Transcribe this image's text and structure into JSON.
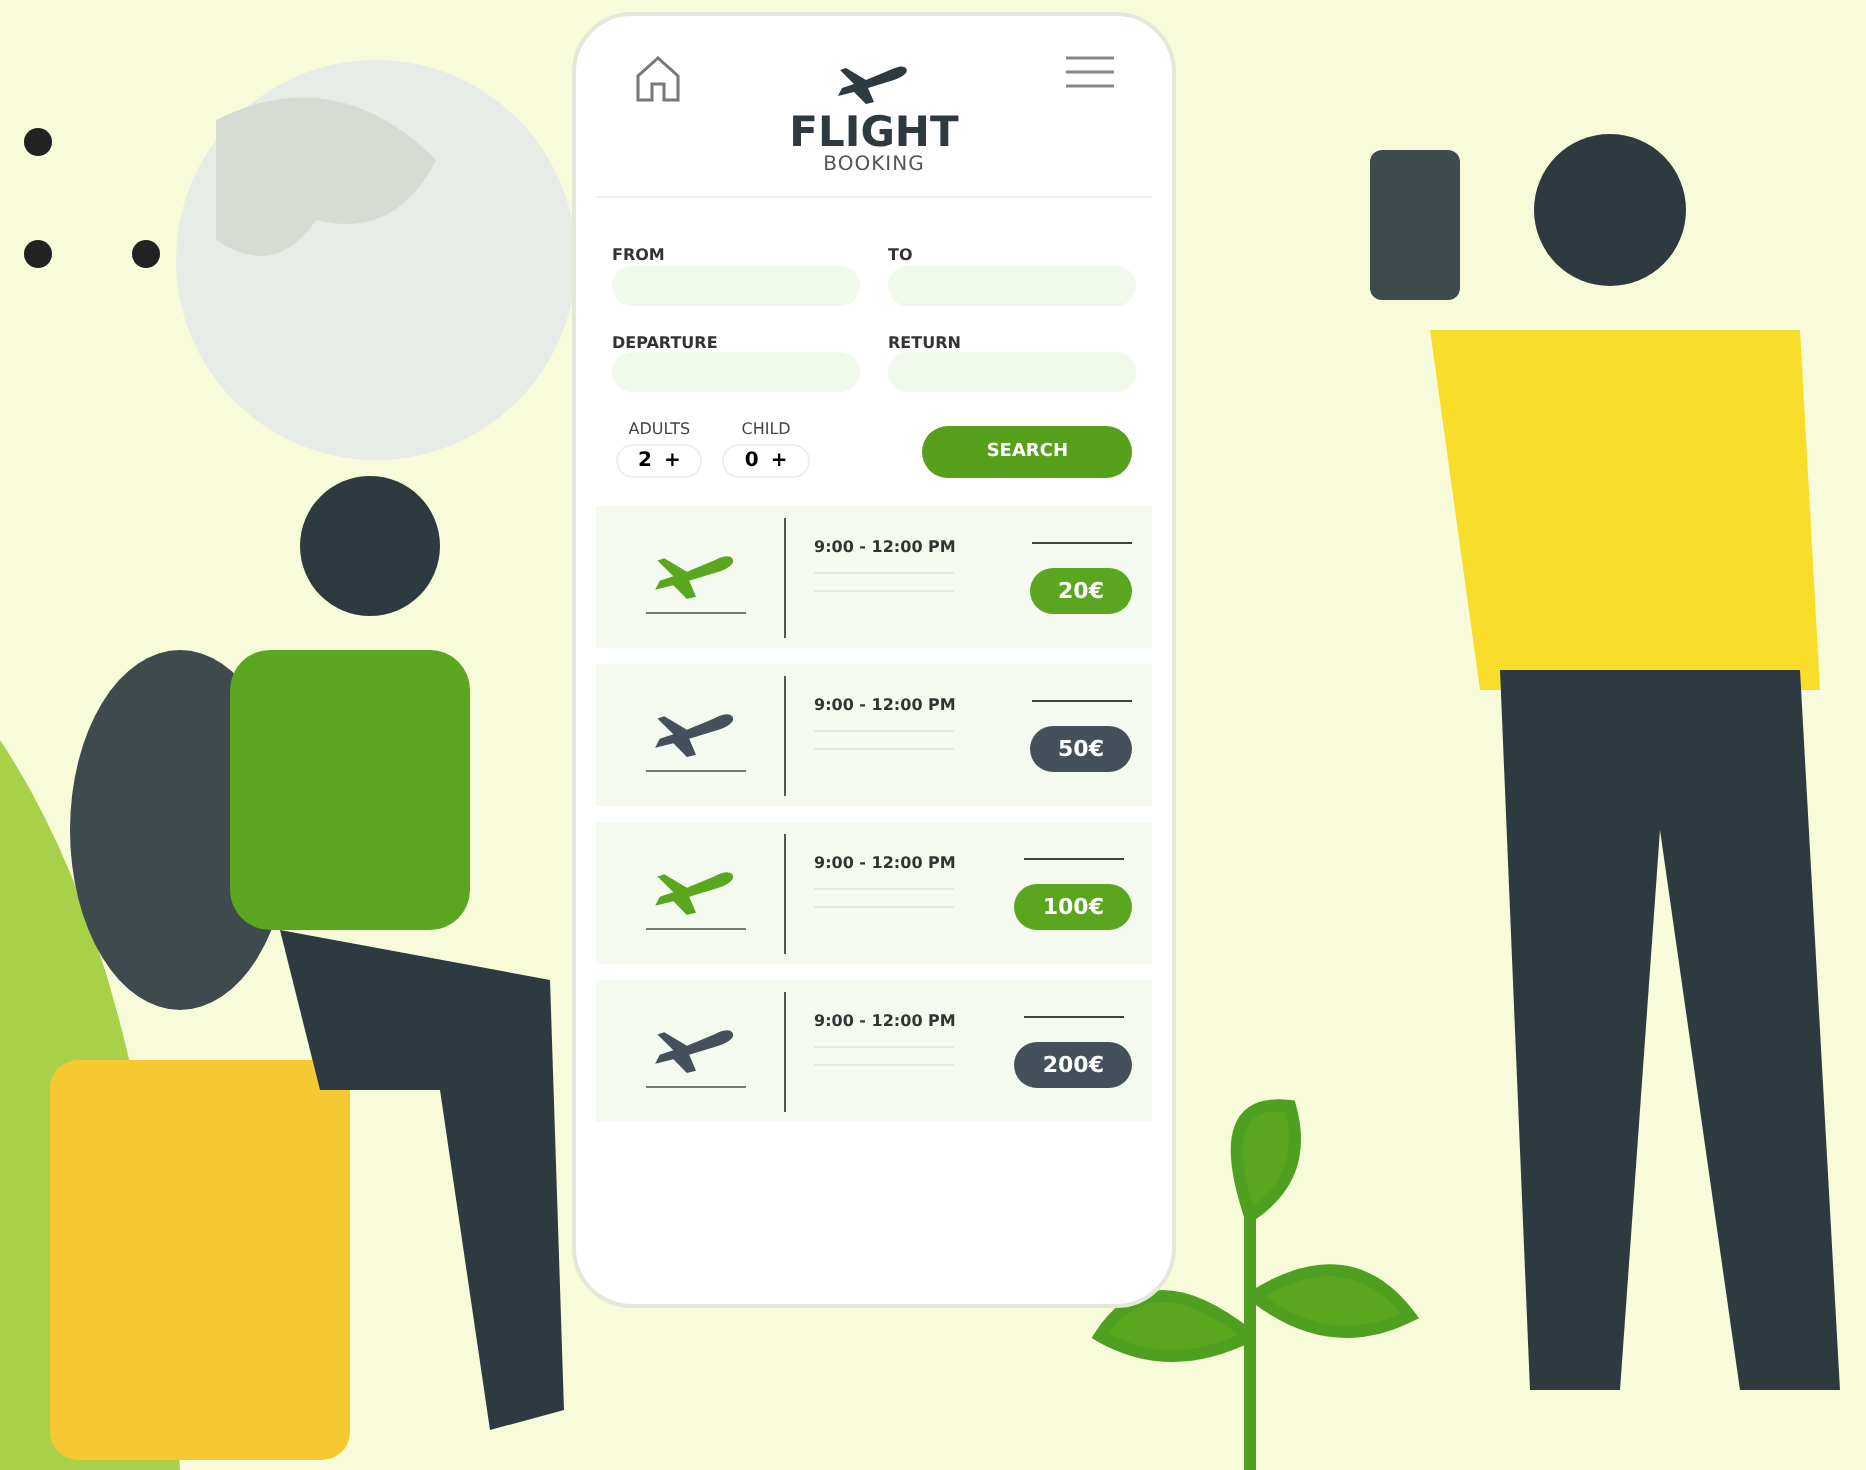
{
  "app": {
    "title": "FLIGHT",
    "subtitle": "BOOKING"
  },
  "form": {
    "fields": [
      {
        "label": "FROM"
      },
      {
        "label": "TO"
      },
      {
        "label": "DEPARTURE"
      },
      {
        "label": "RETURN"
      }
    ],
    "counters": [
      {
        "label": "ADULTS",
        "value": "2",
        "plus": "+"
      },
      {
        "label": "CHILD",
        "value": "0",
        "plus": "+"
      }
    ],
    "search_button": "SEARCH"
  },
  "flights": [
    {
      "time": "9:00 - 12:00 PM",
      "price": "20€",
      "color": "#5aa61e"
    },
    {
      "time": "9:00 - 12:00 PM",
      "price": "50€",
      "color": "#46505a"
    },
    {
      "time": "9:00 - 12:00 PM",
      "price": "100€",
      "color": "#5aa61e"
    },
    {
      "time": "9:00 - 12:00 PM",
      "price": "200€",
      "color": "#46505a"
    }
  ]
}
